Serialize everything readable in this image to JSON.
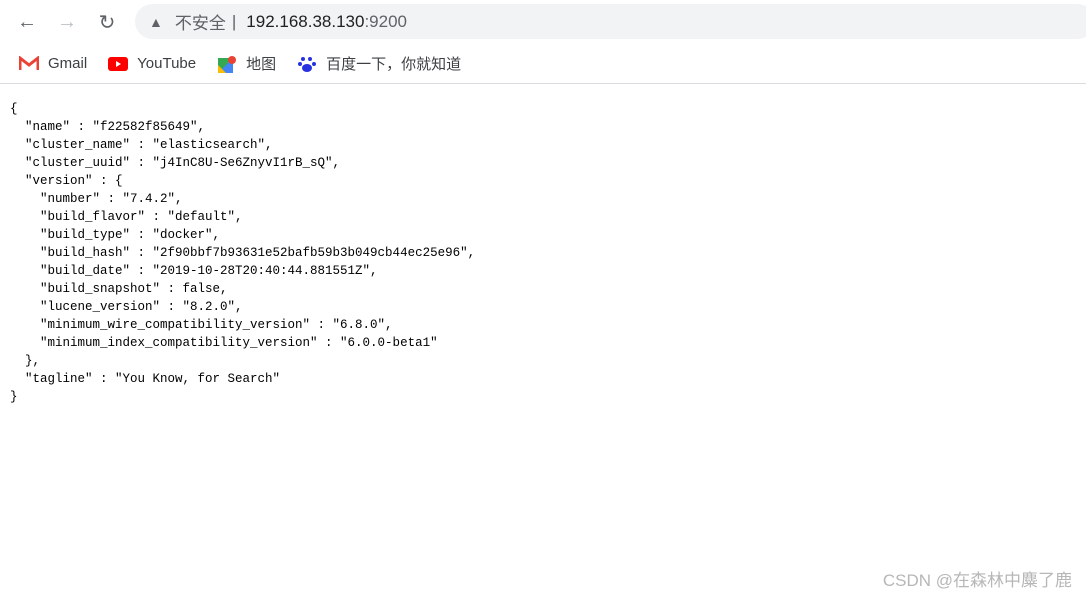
{
  "browser": {
    "insecure_label": "不安全",
    "host": "192.168.38.130",
    "port": ":9200"
  },
  "bookmarks": [
    {
      "label": "Gmail",
      "icon": "gmail-icon"
    },
    {
      "label": "YouTube",
      "icon": "youtube-icon"
    },
    {
      "label": "地图",
      "icon": "maps-icon"
    },
    {
      "label": "百度一下，你就知道",
      "icon": "baidu-icon"
    }
  ],
  "json_lines": [
    "{",
    "  \"name\" : \"f22582f85649\",",
    "  \"cluster_name\" : \"elasticsearch\",",
    "  \"cluster_uuid\" : \"j4InC8U-Se6ZnyvI1rB_sQ\",",
    "  \"version\" : {",
    "    \"number\" : \"7.4.2\",",
    "    \"build_flavor\" : \"default\",",
    "    \"build_type\" : \"docker\",",
    "    \"build_hash\" : \"2f90bbf7b93631e52bafb59b3b049cb44ec25e96\",",
    "    \"build_date\" : \"2019-10-28T20:40:44.881551Z\",",
    "    \"build_snapshot\" : false,",
    "    \"lucene_version\" : \"8.2.0\",",
    "    \"minimum_wire_compatibility_version\" : \"6.8.0\",",
    "    \"minimum_index_compatibility_version\" : \"6.0.0-beta1\"",
    "  },",
    "  \"tagline\" : \"You Know, for Search\"",
    "}"
  ],
  "watermark": "CSDN @在森林中麋了鹿"
}
